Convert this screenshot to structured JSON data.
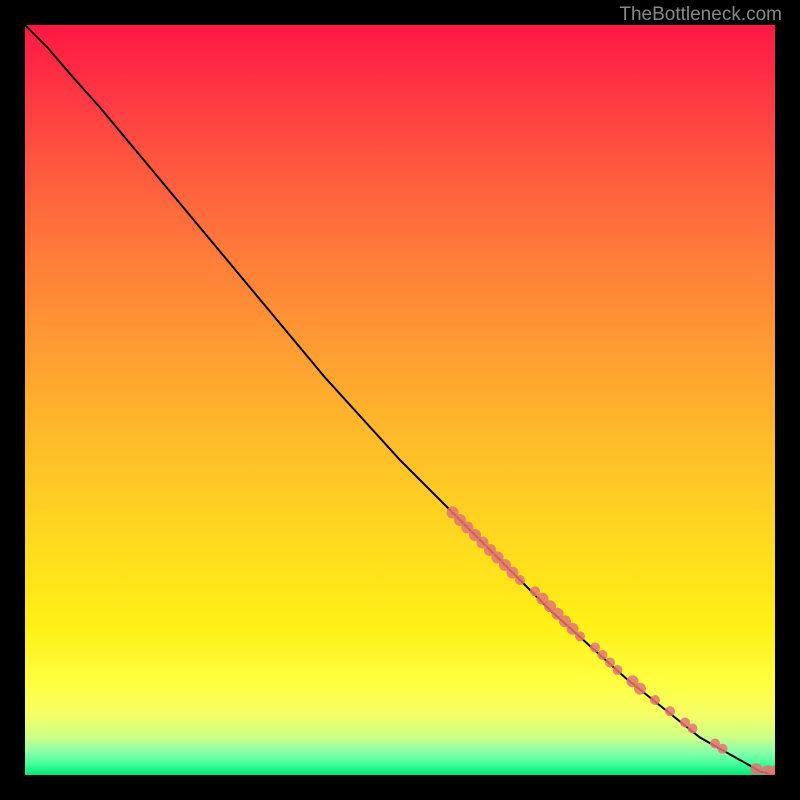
{
  "watermark": "TheBottleneck.com",
  "chart_data": {
    "type": "line",
    "title": "",
    "xlabel": "",
    "ylabel": "",
    "x_range": [
      0,
      100
    ],
    "y_range": [
      0,
      100
    ],
    "series": [
      {
        "name": "curve",
        "type": "line",
        "points": [
          {
            "x": 0,
            "y": 100
          },
          {
            "x": 3,
            "y": 97
          },
          {
            "x": 6,
            "y": 93.5
          },
          {
            "x": 10,
            "y": 89
          },
          {
            "x": 15,
            "y": 83
          },
          {
            "x": 20,
            "y": 77
          },
          {
            "x": 30,
            "y": 65
          },
          {
            "x": 40,
            "y": 53
          },
          {
            "x": 50,
            "y": 42
          },
          {
            "x": 60,
            "y": 32
          },
          {
            "x": 70,
            "y": 22
          },
          {
            "x": 80,
            "y": 13
          },
          {
            "x": 90,
            "y": 5
          },
          {
            "x": 98,
            "y": 0.5
          },
          {
            "x": 100,
            "y": 0
          }
        ]
      },
      {
        "name": "markers",
        "type": "scatter",
        "points": [
          {
            "x": 57,
            "y": 35,
            "r": 6
          },
          {
            "x": 58,
            "y": 34,
            "r": 6
          },
          {
            "x": 59,
            "y": 33,
            "r": 6
          },
          {
            "x": 60,
            "y": 32,
            "r": 6
          },
          {
            "x": 61,
            "y": 31,
            "r": 6
          },
          {
            "x": 62,
            "y": 30,
            "r": 6
          },
          {
            "x": 63,
            "y": 29,
            "r": 6
          },
          {
            "x": 64,
            "y": 28,
            "r": 6
          },
          {
            "x": 65,
            "y": 27,
            "r": 6
          },
          {
            "x": 66,
            "y": 26,
            "r": 5
          },
          {
            "x": 68,
            "y": 24.5,
            "r": 5
          },
          {
            "x": 69,
            "y": 23.5,
            "r": 6
          },
          {
            "x": 70,
            "y": 22.5,
            "r": 6
          },
          {
            "x": 71,
            "y": 21.5,
            "r": 6
          },
          {
            "x": 72,
            "y": 20.5,
            "r": 6
          },
          {
            "x": 73,
            "y": 19.5,
            "r": 6
          },
          {
            "x": 74,
            "y": 18.5,
            "r": 5
          },
          {
            "x": 76,
            "y": 17,
            "r": 5
          },
          {
            "x": 77,
            "y": 16,
            "r": 5
          },
          {
            "x": 78,
            "y": 15,
            "r": 5
          },
          {
            "x": 79,
            "y": 14,
            "r": 5
          },
          {
            "x": 81,
            "y": 12.5,
            "r": 6
          },
          {
            "x": 82,
            "y": 11.5,
            "r": 6
          },
          {
            "x": 84,
            "y": 10,
            "r": 5
          },
          {
            "x": 86,
            "y": 8.5,
            "r": 5
          },
          {
            "x": 88,
            "y": 7,
            "r": 5
          },
          {
            "x": 89,
            "y": 6.2,
            "r": 5
          },
          {
            "x": 92,
            "y": 4.2,
            "r": 5
          },
          {
            "x": 93,
            "y": 3.5,
            "r": 5
          },
          {
            "x": 97.5,
            "y": 0.8,
            "r": 6
          },
          {
            "x": 99,
            "y": 0.5,
            "r": 6
          },
          {
            "x": 100,
            "y": 0.5,
            "r": 6
          }
        ]
      }
    ],
    "background_gradient": {
      "type": "vertical",
      "stops": [
        {
          "pos": 0,
          "color": "#ff1744"
        },
        {
          "pos": 50,
          "color": "#ffbb2a"
        },
        {
          "pos": 88,
          "color": "#ffff44"
        },
        {
          "pos": 100,
          "color": "#00e676"
        }
      ]
    }
  }
}
